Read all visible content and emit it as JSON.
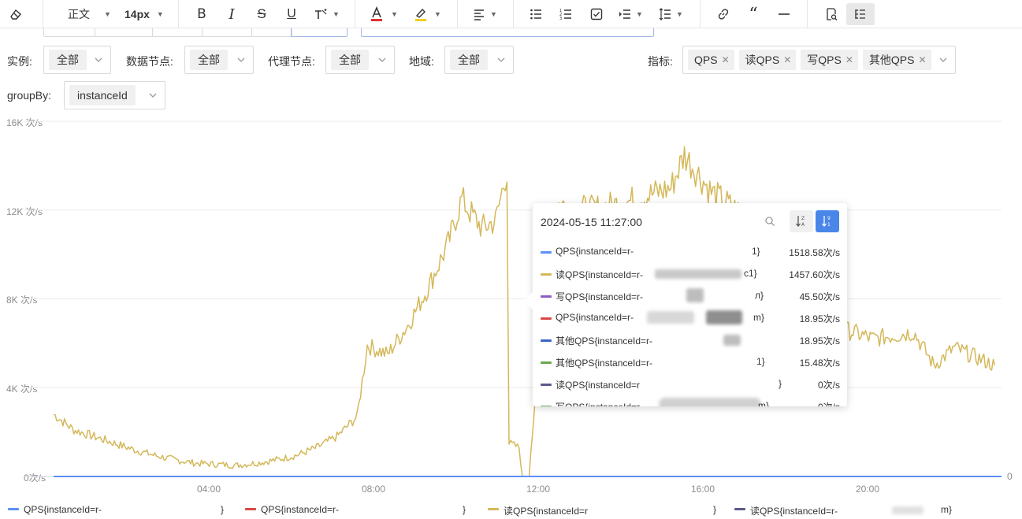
{
  "toolbar": {
    "paragraph": "正文",
    "font_size": "14px"
  },
  "filters": {
    "instance": {
      "label": "实例:",
      "value": "全部"
    },
    "data_node": {
      "label": "数据节点:",
      "value": "全部"
    },
    "proxy_node": {
      "label": "代理节点:",
      "value": "全部"
    },
    "region": {
      "label": "地域:",
      "value": "全部"
    },
    "metrics": {
      "label": "指标:",
      "tags": [
        "QPS",
        "读QPS",
        "写QPS",
        "其他QPS"
      ]
    },
    "group_by": {
      "label": "groupBy:",
      "value": "instanceId"
    }
  },
  "chart": {
    "y_ticks": [
      "16K 次/s",
      "12K 次/s",
      "8K 次/s",
      "4K 次/s",
      "0次/s"
    ],
    "x_ticks": [
      "04:00",
      "08:00",
      "12:00",
      "16:00",
      "20:00"
    ],
    "right_axis_label": "0"
  },
  "chart_data": {
    "type": "line",
    "x_ticks": [
      "04:00",
      "08:00",
      "12:00",
      "16:00",
      "20:00"
    ],
    "x_range": [
      "00:15",
      "23:40"
    ],
    "y_unit": "次/s",
    "ylim": [
      0,
      16000
    ],
    "grid": true,
    "series": [
      {
        "name": "读QPS(instanceId=r-...)",
        "color": "#d4b85a",
        "points": [
          [
            "00:15",
            2800
          ],
          [
            "00:45",
            2100
          ],
          [
            "01:15",
            1800
          ],
          [
            "01:45",
            1500
          ],
          [
            "02:15",
            1200
          ],
          [
            "02:45",
            950
          ],
          [
            "03:15",
            750
          ],
          [
            "03:45",
            600
          ],
          [
            "04:15",
            550
          ],
          [
            "04:45",
            500
          ],
          [
            "05:15",
            600
          ],
          [
            "05:45",
            750
          ],
          [
            "06:15",
            950
          ],
          [
            "06:45",
            1300
          ],
          [
            "07:15",
            1800
          ],
          [
            "07:45",
            2700
          ],
          [
            "08:00",
            5900
          ],
          [
            "08:30",
            5500
          ],
          [
            "09:00",
            6800
          ],
          [
            "09:30",
            8500
          ],
          [
            "10:00",
            10500
          ],
          [
            "10:20",
            12500
          ],
          [
            "10:30",
            12000
          ],
          [
            "10:50",
            11200
          ],
          [
            "11:10",
            11500
          ],
          [
            "11:27",
            13800
          ],
          [
            "11:30",
            1500
          ],
          [
            "11:45",
            1300
          ],
          [
            "11:50",
            0
          ],
          [
            "12:00",
            0
          ],
          [
            "12:30",
            12300
          ],
          [
            "13:30",
            12000
          ],
          [
            "14:30",
            12400
          ],
          [
            "15:30",
            13000
          ],
          [
            "15:50",
            14500
          ],
          [
            "16:30",
            12800
          ],
          [
            "17:30",
            11500
          ],
          [
            "18:00",
            8200
          ],
          [
            "18:30",
            7600
          ],
          [
            "19:30",
            6800
          ],
          [
            "20:30",
            6200
          ],
          [
            "21:30",
            6500
          ],
          [
            "22:00",
            5000
          ],
          [
            "22:30",
            5800
          ],
          [
            "23:30",
            5000
          ]
        ]
      },
      {
        "name": "QPS(instanceId=r-...)",
        "color": "#5b8ff9",
        "points": [
          [
            "00:15",
            0
          ],
          [
            "11:27",
            0
          ],
          [
            "15:55",
            0
          ],
          [
            "23:40",
            0
          ]
        ]
      }
    ]
  },
  "tooltip": {
    "time": "2024-05-15 11:27:00",
    "rows": [
      {
        "name": "QPS{instanceId=r-",
        "suffix": "1}",
        "value": "1518.58次/s",
        "color": "#5b8ff9"
      },
      {
        "name": "读QPS{instanceId=r-",
        "suffix": "c1}",
        "value": "1457.60次/s",
        "color": "#d4b85a"
      },
      {
        "name": "写QPS{instanceId=r-",
        "suffix": "л}",
        "value": "45.50次/s",
        "color": "#8c5fc4"
      },
      {
        "name": "QPS{instanceId=r-",
        "suffix": "m}",
        "value": "18.95次/s",
        "color": "#d94848"
      },
      {
        "name": "其他QPS{instanceId=r-",
        "suffix": "",
        "value": "18.95次/s",
        "color": "#3a63c8"
      },
      {
        "name": "其他QPS{instanceId=r-",
        "suffix": "1}",
        "value": "15.48次/s",
        "color": "#6aa84f"
      },
      {
        "name": "读QPS{instanceId=r",
        "suffix": "}",
        "value": "0次/s",
        "color": "#5a5a8c"
      },
      {
        "name": "写QPS{instanceId=r-",
        "suffix": "m}",
        "value": "0次/s",
        "color": "#6aa84f"
      }
    ]
  },
  "legend": [
    {
      "label": "QPS{instanceId=r-",
      "suffix": "}",
      "color": "#5b8ff9"
    },
    {
      "label": "QPS{instanceId=r-",
      "suffix": "}",
      "color": "#d94848"
    },
    {
      "label": "读QPS{instanceId=r",
      "suffix": "}",
      "color": "#d4b85a"
    },
    {
      "label": "读QPS{instanceId=r-",
      "suffix": "m}",
      "color": "#5a5a8c"
    }
  ]
}
